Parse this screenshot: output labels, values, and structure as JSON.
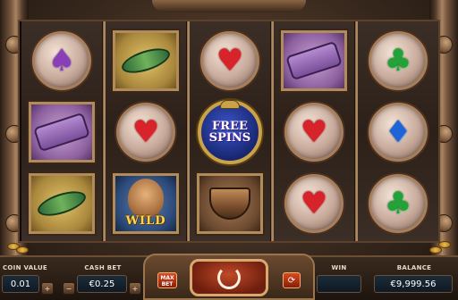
{
  "reels": [
    {
      "symbols": [
        {
          "kind": "round",
          "suit": "spade",
          "glyph": "♠"
        },
        {
          "kind": "square",
          "tile": "purple",
          "icon": "scroll"
        },
        {
          "kind": "square",
          "tile": "gold",
          "icon": "jade-dragon"
        }
      ]
    },
    {
      "symbols": [
        {
          "kind": "square",
          "tile": "gold",
          "icon": "jade-dragon"
        },
        {
          "kind": "round",
          "suit": "heart",
          "glyph": "♥"
        },
        {
          "kind": "wild",
          "tile": "blue",
          "label": "WILD"
        }
      ]
    },
    {
      "symbols": [
        {
          "kind": "round",
          "suit": "heart",
          "glyph": "♥"
        },
        {
          "kind": "free",
          "line1": "FREE",
          "line2": "SPINS"
        },
        {
          "kind": "square",
          "tile": "brown",
          "icon": "cauldron"
        }
      ]
    },
    {
      "symbols": [
        {
          "kind": "square",
          "tile": "purple",
          "icon": "scroll"
        },
        {
          "kind": "round",
          "suit": "heart",
          "glyph": "♥"
        },
        {
          "kind": "round",
          "suit": "heart",
          "glyph": "♥"
        }
      ]
    },
    {
      "symbols": [
        {
          "kind": "round",
          "suit": "club",
          "glyph": "♣"
        },
        {
          "kind": "round",
          "suit": "diamond",
          "glyph": "♦"
        },
        {
          "kind": "round",
          "suit": "club",
          "glyph": "♣"
        }
      ]
    }
  ],
  "controls": {
    "coin_value": {
      "label": "COIN VALUE",
      "value": "0.01"
    },
    "cash_bet": {
      "label": "CASH BET",
      "value": "€0.25"
    },
    "win": {
      "label": "WIN",
      "value": ""
    },
    "balance": {
      "label": "BALANCE",
      "value": "€9,999.56"
    },
    "max_bet_line1": "MAX",
    "max_bet_line2": "BET",
    "decrease": "−",
    "increase": "+"
  },
  "colors": {
    "accent": "#c04a28",
    "frame": "#9a754e",
    "panel": "#1b2b38"
  }
}
